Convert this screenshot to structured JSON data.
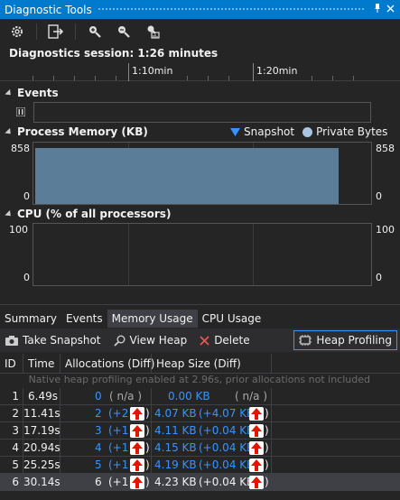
{
  "window": {
    "title": "Diagnostic Tools",
    "pin_icon": "pin-icon",
    "close_icon": "close-icon"
  },
  "toolbar": {
    "tools": [
      "gear-icon",
      "select-tools-icon",
      "zoom-in-icon",
      "zoom-out-icon",
      "reset-zoom-icon"
    ]
  },
  "session": {
    "label": "Diagnostics session: 1:26 minutes"
  },
  "timeline": {
    "ticks": [
      "1:10min",
      "1:20min"
    ]
  },
  "events": {
    "header": "Events"
  },
  "memory": {
    "header": "Process Memory (KB)",
    "legend": {
      "snapshot": "Snapshot",
      "private_bytes": "Private Bytes"
    },
    "colors": {
      "snapshot": "#3794ff",
      "private_bytes": "#a8c6e0",
      "fill": "#5b7d97"
    },
    "y_max_left": "858",
    "y_min_left": "0",
    "y_max_right": "858",
    "y_min_right": "0"
  },
  "cpu": {
    "header": "CPU (% of all processors)",
    "y_max_left": "100",
    "y_min_left": "0",
    "y_max_right": "100",
    "y_min_right": "0"
  },
  "tabs": [
    "Summary",
    "Events",
    "Memory Usage",
    "CPU Usage"
  ],
  "active_tab": "Memory Usage",
  "actions": {
    "take_snapshot": "Take Snapshot",
    "view_heap": "View Heap",
    "delete": "Delete",
    "heap_profiling": "Heap Profiling"
  },
  "table": {
    "columns": [
      "ID",
      "Time",
      "Allocations (Diff)",
      "Heap Size (Diff)"
    ],
    "notice": "Native heap profiling enabled at 2.96s, prior allocations not included",
    "rows": [
      {
        "id": "1",
        "time": "6.49s",
        "alloc": "0",
        "alloc_diff": "( n/a )",
        "heap": "0.00 KB",
        "heap_diff": "( n/a )"
      },
      {
        "id": "2",
        "time": "11.41s",
        "alloc": "2",
        "alloc_diff": "(+2",
        "heap": "4.07 KB",
        "heap_diff": "(+4.07 KB"
      },
      {
        "id": "3",
        "time": "17.19s",
        "alloc": "3",
        "alloc_diff": "(+1",
        "heap": "4.11 KB",
        "heap_diff": "(+0.04 KB"
      },
      {
        "id": "4",
        "time": "20.94s",
        "alloc": "4",
        "alloc_diff": "(+1",
        "heap": "4.15 KB",
        "heap_diff": "(+0.04 KB"
      },
      {
        "id": "5",
        "time": "25.25s",
        "alloc": "5",
        "alloc_diff": "(+1",
        "heap": "4.19 KB",
        "heap_diff": "(+0.04 KB"
      },
      {
        "id": "6",
        "time": "30.14s",
        "alloc": "6",
        "alloc_diff": "(+1",
        "heap": "4.23 KB",
        "heap_diff": "(+0.04 KB"
      }
    ],
    "close_paren": ")"
  }
}
